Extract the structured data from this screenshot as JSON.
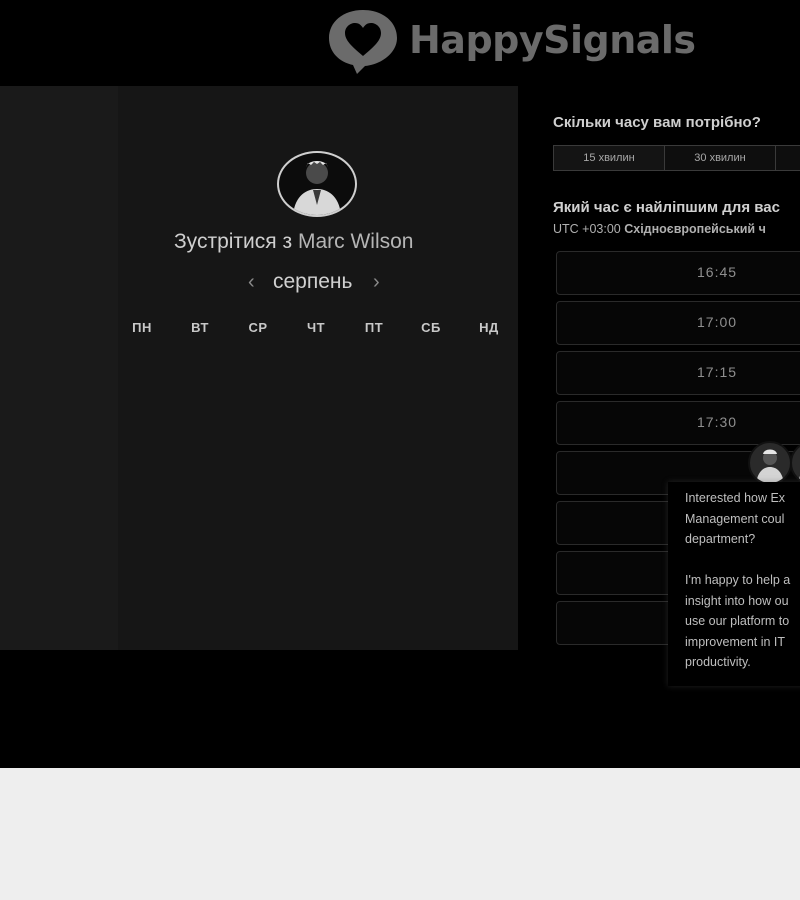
{
  "brand": {
    "name": "HappySignals"
  },
  "calendar": {
    "meet_prefix": "Зустрітися з",
    "host_name": "Marc Wilson",
    "month": "серпень",
    "prev_arrow": "‹",
    "next_arrow": "›",
    "weekdays": [
      "ПН",
      "ВТ",
      "СР",
      "ЧТ",
      "ПТ",
      "СБ",
      "НД"
    ]
  },
  "scheduler": {
    "duration_question": "Скільки часу вам потрібно?",
    "durations": [
      "15 хвилин",
      "30 хвилин"
    ],
    "time_question": "Який час є найліпшим для вас",
    "timezone_offset": "UTC +03:00",
    "timezone_name": "Східноєвропейський ч",
    "slots": [
      "16:45",
      "17:00",
      "17:15",
      "17:30"
    ]
  },
  "chat": {
    "message": "Interested how Ex\nManagement coul\ndepartment?\n\nI'm happy to help a\ninsight into how ou\nuse our platform to\nimprovement in IT\nproductivity."
  },
  "colors": {
    "background": "#000000",
    "panel": "#1a1a1a",
    "logo": "#6b6b6b",
    "page_bottom": "#eeeeee"
  }
}
